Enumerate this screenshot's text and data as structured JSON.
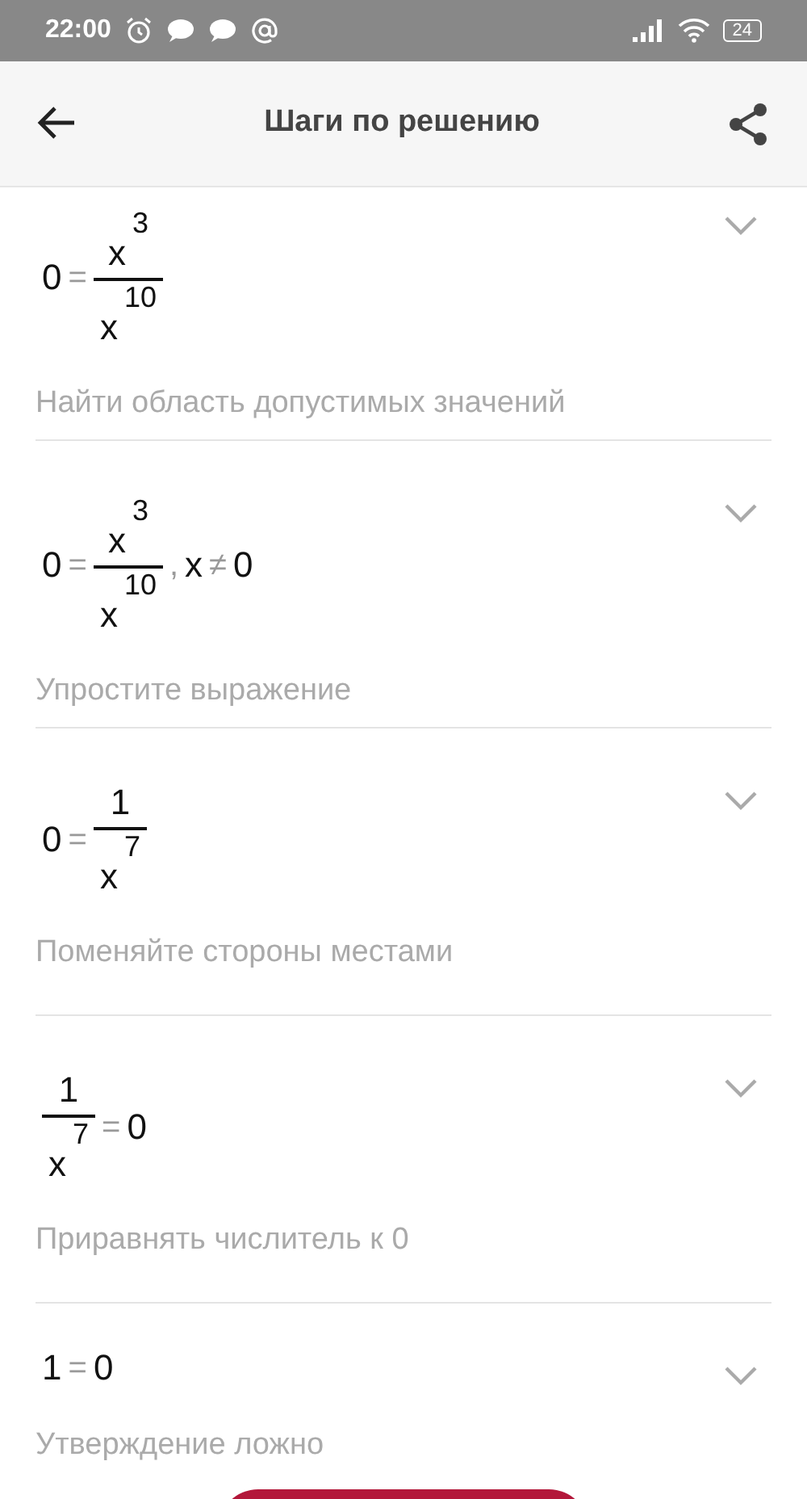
{
  "status_bar": {
    "time": "22:00",
    "battery": "24"
  },
  "app_bar": {
    "title": "Шаги по решению"
  },
  "steps": [
    {
      "expanded": false,
      "formula": [
        {
          "kind": "text",
          "text": "0"
        },
        {
          "kind": "op",
          "text": "="
        },
        {
          "kind": "frac",
          "num": [
            {
              "kind": "power",
              "base": "x",
              "exp": "3"
            }
          ],
          "den": [
            {
              "kind": "power",
              "base": "x",
              "exp": "10"
            }
          ]
        }
      ],
      "description": "Найти область допустимых значений"
    },
    {
      "expanded": false,
      "formula": [
        {
          "kind": "text",
          "text": "0"
        },
        {
          "kind": "op",
          "text": "="
        },
        {
          "kind": "frac",
          "num": [
            {
              "kind": "power",
              "base": "x",
              "exp": "3"
            }
          ],
          "den": [
            {
              "kind": "power",
              "base": "x",
              "exp": "10"
            }
          ]
        },
        {
          "kind": "op",
          "text": ","
        },
        {
          "kind": "text",
          "text": "x"
        },
        {
          "kind": "op",
          "text": "≠"
        },
        {
          "kind": "text",
          "text": "0"
        }
      ],
      "description": "Упростите выражение"
    },
    {
      "expanded": false,
      "formula": [
        {
          "kind": "text",
          "text": "0"
        },
        {
          "kind": "op",
          "text": "="
        },
        {
          "kind": "frac",
          "num": [
            {
              "kind": "text",
              "text": "1"
            }
          ],
          "den": [
            {
              "kind": "power",
              "base": "x",
              "exp": "7"
            }
          ]
        }
      ],
      "description": "Поменяйте стороны местами"
    },
    {
      "expanded": false,
      "formula": [
        {
          "kind": "frac",
          "num": [
            {
              "kind": "text",
              "text": "1"
            }
          ],
          "den": [
            {
              "kind": "power",
              "base": "x",
              "exp": "7"
            }
          ]
        },
        {
          "kind": "op",
          "text": "="
        },
        {
          "kind": "text",
          "text": "0"
        }
      ],
      "description": "Приравнять числитель к 0"
    },
    {
      "expanded": false,
      "formula": [
        {
          "kind": "text",
          "text": "1"
        },
        {
          "kind": "op",
          "text": "="
        },
        {
          "kind": "text",
          "text": "0"
        }
      ],
      "description": "Утверждение ложно"
    }
  ]
}
